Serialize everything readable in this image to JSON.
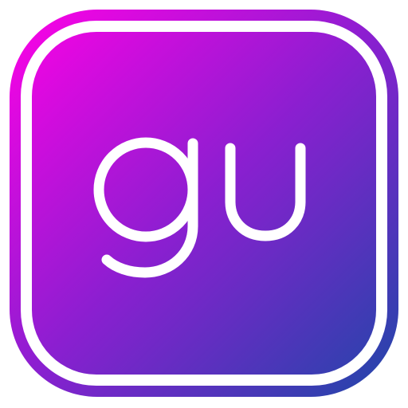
{
  "logo": {
    "text": "gu",
    "icon": "app-icon-rounded-square",
    "colors": {
      "gradient_start": "#ff00e6",
      "gradient_mid": "#8a1fd0",
      "gradient_end": "#1f47a8",
      "ring": "#ffffff",
      "letters": "#ffffff"
    }
  }
}
